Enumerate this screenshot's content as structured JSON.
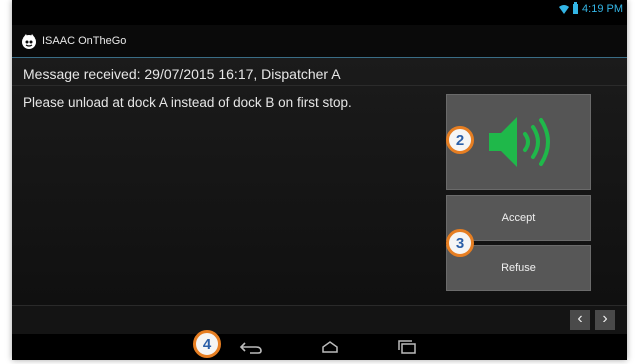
{
  "status_bar": {
    "time": "4:19 PM"
  },
  "app": {
    "title": "ISAAC OnTheGo"
  },
  "message": {
    "header": "Message received: 29/07/2015 16:17, Dispatcher A",
    "body": "Please unload at dock A instead of dock B on first stop."
  },
  "actions": {
    "accept_label": "Accept",
    "refuse_label": "Refuse",
    "sound_icon": "speaker-icon"
  },
  "pager": {
    "prev": "‹",
    "next": "›"
  },
  "callouts": {
    "c2": "2",
    "c3": "3",
    "c4": "4"
  },
  "colors": {
    "accent": "#33b5e5",
    "speaker": "#1fb84a",
    "callout_border": "#e67e22",
    "callout_text": "#2b5fa8"
  }
}
